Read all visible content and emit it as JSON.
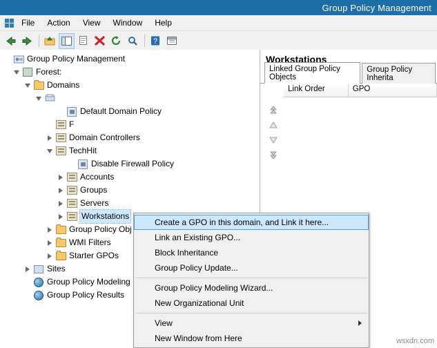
{
  "window": {
    "title": "Group Policy Management"
  },
  "menubar": {
    "items": [
      {
        "label": "File"
      },
      {
        "label": "Action"
      },
      {
        "label": "View"
      },
      {
        "label": "Window"
      },
      {
        "label": "Help"
      }
    ]
  },
  "toolbar": {
    "buttons": [
      {
        "name": "back-button",
        "glyph": "⇦"
      },
      {
        "name": "forward-button",
        "glyph": "⇨"
      },
      {
        "name": "up-folder-button",
        "glyph": "⬆"
      },
      {
        "name": "show-tree-button",
        "glyph": "▤"
      },
      {
        "name": "properties-button",
        "glyph": "▧"
      },
      {
        "name": "delete-button",
        "glyph": "✖"
      },
      {
        "name": "refresh-button",
        "glyph": "⟳"
      },
      {
        "name": "search-button",
        "glyph": "⌕"
      },
      {
        "name": "help-button",
        "glyph": "?"
      },
      {
        "name": "new-window-button",
        "glyph": "▣"
      },
      {
        "name": "show-pane-button",
        "glyph": "▥"
      }
    ]
  },
  "tree": {
    "root": "Group Policy Management",
    "nodes": [
      {
        "label": "Group Policy Management",
        "indent": 0,
        "twisty": "",
        "icon": "gpm-icon"
      },
      {
        "label": "Forest:",
        "indent": 1,
        "twisty": "expanded",
        "icon": "forest-icon"
      },
      {
        "label": "Domains",
        "indent": 2,
        "twisty": "expanded",
        "icon": "folder-icon"
      },
      {
        "label": "",
        "indent": 3,
        "twisty": "expanded",
        "icon": "domain-icon"
      },
      {
        "label": "Default Domain Policy",
        "indent": 5,
        "twisty": "",
        "icon": "gpo-icon"
      },
      {
        "label": "F",
        "indent": 4,
        "twisty": "",
        "icon": "ou-icon"
      },
      {
        "label": "Domain Controllers",
        "indent": 4,
        "twisty": "collapsed",
        "icon": "ou-icon"
      },
      {
        "label": "TechHit",
        "indent": 4,
        "twisty": "expanded",
        "icon": "ou-icon"
      },
      {
        "label": "Disable Firewall Policy",
        "indent": 6,
        "twisty": "",
        "icon": "gpo-icon"
      },
      {
        "label": "Accounts",
        "indent": 5,
        "twisty": "collapsed",
        "icon": "ou-icon"
      },
      {
        "label": "Groups",
        "indent": 5,
        "twisty": "collapsed",
        "icon": "ou-icon"
      },
      {
        "label": "Servers",
        "indent": 5,
        "twisty": "collapsed",
        "icon": "ou-icon"
      },
      {
        "label": "Workstations",
        "indent": 5,
        "twisty": "collapsed",
        "icon": "ou-icon",
        "selected": true
      },
      {
        "label": "Group Policy Obj",
        "indent": 4,
        "twisty": "collapsed",
        "icon": "folder-icon"
      },
      {
        "label": "WMI Filters",
        "indent": 4,
        "twisty": "collapsed",
        "icon": "folder-icon"
      },
      {
        "label": "Starter GPOs",
        "indent": 4,
        "twisty": "collapsed",
        "icon": "folder-icon"
      },
      {
        "label": "Sites",
        "indent": 2,
        "twisty": "collapsed",
        "icon": "sites-icon"
      },
      {
        "label": "Group Policy Modeling",
        "indent": 2,
        "twisty": "",
        "icon": "gm-icon"
      },
      {
        "label": "Group Policy Results",
        "indent": 2,
        "twisty": "",
        "icon": "gm-icon"
      }
    ]
  },
  "right_pane": {
    "header": "Workstations",
    "tabs": [
      {
        "label": "Linked Group Policy Objects",
        "active": true
      },
      {
        "label": "Group Policy Inherita",
        "active": false
      }
    ],
    "columns": [
      {
        "label": "Link Order",
        "width": 100
      },
      {
        "label": "GPO",
        "width": 140
      }
    ],
    "order_buttons": [
      {
        "name": "move-top-button",
        "glyph": "⇈"
      },
      {
        "name": "move-up-button",
        "glyph": "△"
      },
      {
        "name": "move-down-button",
        "glyph": "▽"
      },
      {
        "name": "move-bottom-button",
        "glyph": "⇊"
      }
    ]
  },
  "context_menu": {
    "items": [
      {
        "label": "Create a GPO in this domain, and Link it here...",
        "highlight": true,
        "sep_after": false
      },
      {
        "label": "Link an Existing GPO...",
        "sep_after": false
      },
      {
        "label": "Block Inheritance",
        "sep_after": false
      },
      {
        "label": "Group Policy Update...",
        "sep_after": true
      },
      {
        "label": "Group Policy Modeling Wizard...",
        "sep_after": false
      },
      {
        "label": "New Organizational Unit",
        "sep_after": true
      },
      {
        "label": "View",
        "submenu": true,
        "sep_after": false
      },
      {
        "label": "New Window from Here",
        "sep_after": false
      }
    ]
  },
  "watermark": "wsxdn.com",
  "colors": {
    "title_bar": "#1d6ea8",
    "highlight": "#cce8ff",
    "selection": "#cde8ff"
  }
}
